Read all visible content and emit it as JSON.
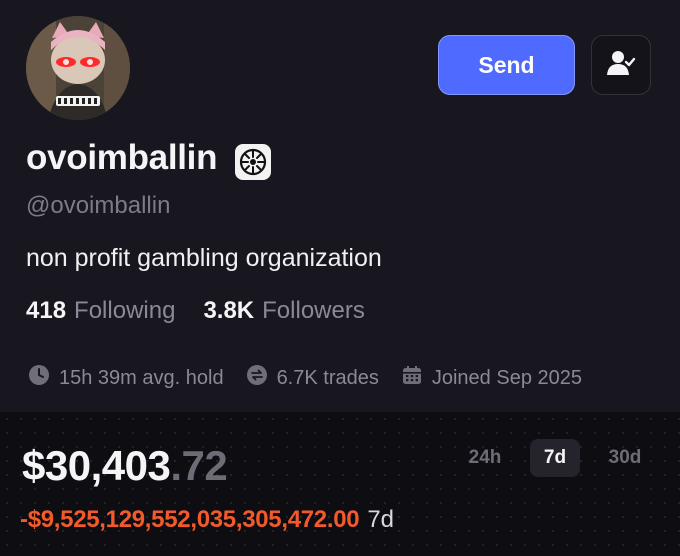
{
  "profile": {
    "display_name": "ovoimballin",
    "handle": "@ovoimballin",
    "bio": "non profit gambling organization",
    "following_count": "418",
    "following_label": "Following",
    "followers_count": "3.8K",
    "followers_label": "Followers",
    "avg_hold": "15h 39m avg. hold",
    "trades": "6.7K trades",
    "joined": "Joined Sep 2025"
  },
  "actions": {
    "send_label": "Send",
    "follow_icon": "user-check-icon"
  },
  "portfolio": {
    "balance_main": "$30,403",
    "balance_cents": ".72",
    "pnl_value": "-$9,525,129,552,035,305,472.00",
    "pnl_period": "7d",
    "ranges": [
      "24h",
      "7d",
      "30d"
    ],
    "active_range": "7d"
  },
  "colors": {
    "accent": "#4f6bff",
    "loss": "#f25a2c",
    "background": "#18171f"
  }
}
